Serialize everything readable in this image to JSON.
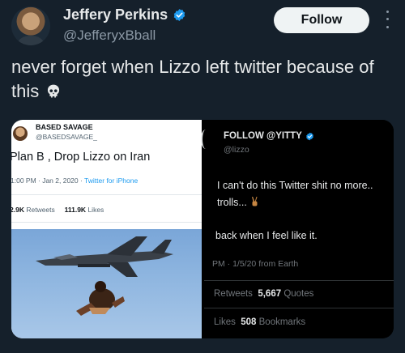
{
  "tweet": {
    "author_name": "Jeffery Perkins",
    "author_handle": "@JefferyxBball",
    "follow_label": "Follow",
    "text": "never forget when Lizzo left twitter because of this",
    "text_icon": "skull-icon",
    "verified_icon": "verified-badge-icon"
  },
  "left_shot": {
    "name": "BASED SAVAGE",
    "handle": "@BASEDSAVAGE_",
    "text": "Plan B , Drop Lizzo on Iran",
    "meta_time": "1:00 PM · Jan 2, 2020 · ",
    "meta_source": "Twitter for iPhone",
    "retweets_value": "2.9K",
    "retweets_label": "Retweets",
    "likes_value": "111.9K",
    "likes_label": "Likes"
  },
  "right_shot": {
    "name": "FOLLOW @YITTY",
    "handle": "@lizzo",
    "line1": "I can't do this Twitter shit no more..",
    "line2": "trolls...",
    "line3": "back when I feel like it.",
    "meta": "PM · 1/5/20 from Earth",
    "retweets_label": "Retweets",
    "quotes_value": "5,667",
    "quotes_label": "Quotes",
    "likes_label": "Likes",
    "bookmarks_value": "508",
    "bookmarks_label": "Bookmarks"
  },
  "colors": {
    "background": "#15202b",
    "verified_blue": "#1d9bf0",
    "follow_button": "#eff3f4"
  }
}
